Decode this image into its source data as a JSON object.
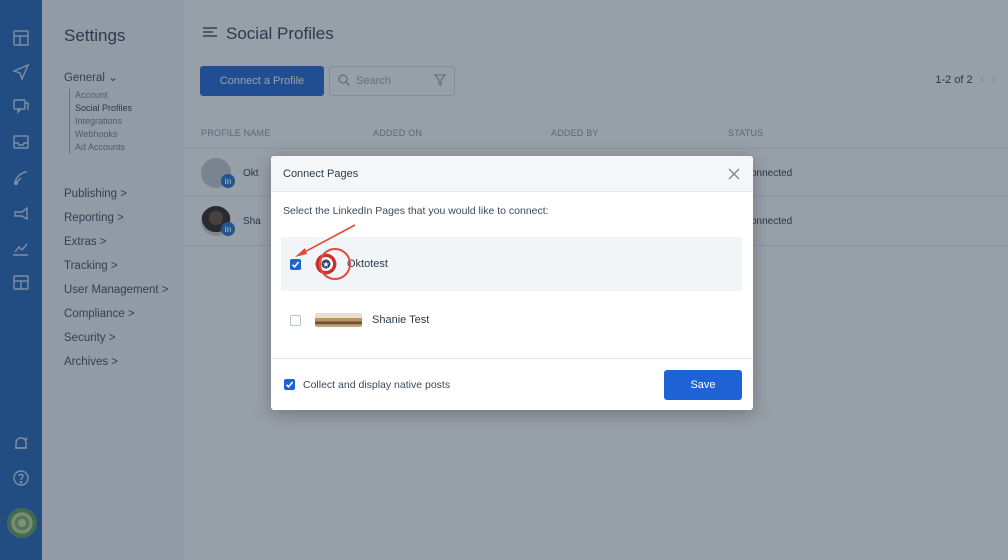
{
  "sidebar": {
    "title": "Settings",
    "general_label": "General",
    "sub_items": [
      {
        "label": "Account"
      },
      {
        "label": "Social Profiles"
      },
      {
        "label": "Integrations"
      },
      {
        "label": "Webhooks"
      },
      {
        "label": "Ad Accounts"
      }
    ],
    "groups": [
      {
        "label": "Publishing >"
      },
      {
        "label": "Reporting >"
      },
      {
        "label": "Extras >"
      },
      {
        "label": "Tracking >"
      },
      {
        "label": "User Management >"
      },
      {
        "label": "Compliance >"
      },
      {
        "label": "Security >"
      },
      {
        "label": "Archives >"
      }
    ]
  },
  "rail_icons": [
    "dashboard-icon",
    "send-icon",
    "chat-icon",
    "inbox-icon",
    "satellite-icon",
    "megaphone-icon",
    "analytics-icon",
    "calendar-icon",
    "bell-icon",
    "help-icon"
  ],
  "main": {
    "title": "Social Profiles",
    "connect_button": "Connect a Profile",
    "search_placeholder": "Search",
    "pagination": "1-2 of 2",
    "columns": [
      "PROFILE NAME",
      "ADDED ON",
      "ADDED BY",
      "STATUS"
    ],
    "rows": [
      {
        "name": "Okt",
        "status": "onnected",
        "badge": "in"
      },
      {
        "name": "Sha",
        "status": "onnected",
        "badge": "in"
      }
    ]
  },
  "modal": {
    "title": "Connect Pages",
    "instruction": "Select the LinkedIn Pages that you would like to connect:",
    "pages": [
      {
        "name": "Oktotest",
        "checked": true
      },
      {
        "name": "Shanie Test",
        "checked": false
      }
    ],
    "footer_checkbox_label": "Collect and display native posts",
    "footer_checked": true,
    "save_button": "Save"
  },
  "colors": {
    "rail": "#1e63b8",
    "primary_button": "#1e63d6",
    "highlight_ring": "#e34a3a",
    "overlay": "rgba(38,55,74,0.48)"
  }
}
